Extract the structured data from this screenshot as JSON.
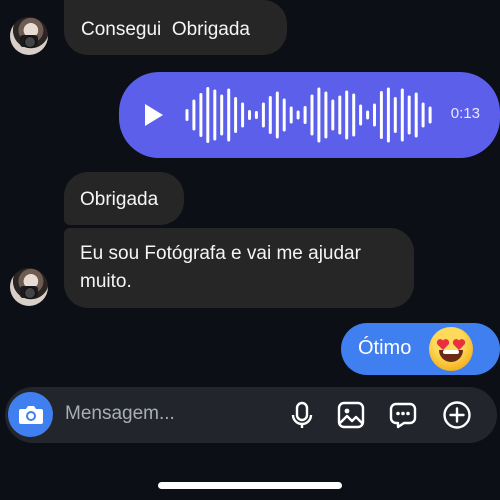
{
  "messages": {
    "incoming_1": "Consegui  Obrigada",
    "voice_duration": "0:13",
    "incoming_2": "Obrigada",
    "incoming_3_line1": "Eu sou Fotógrafa e vai me ajudar",
    "incoming_3_line2": "muito.",
    "outgoing_1": "Ótimo"
  },
  "composer": {
    "placeholder": "Mensagem..."
  },
  "icons": {
    "camera": "camera-icon",
    "mic": "microphone-icon",
    "gallery": "image-icon",
    "sticker": "chat-bubble-icon",
    "add": "plus-circle-icon",
    "play": "play-icon",
    "emoji": "heart-eyes-emoji"
  },
  "colors": {
    "background": "#0c0f16",
    "incoming_bubble": "#262626",
    "voice_bubble": "#5b5fea",
    "outgoing_bubble": "#3f7ff0",
    "composer": "#22252b"
  }
}
